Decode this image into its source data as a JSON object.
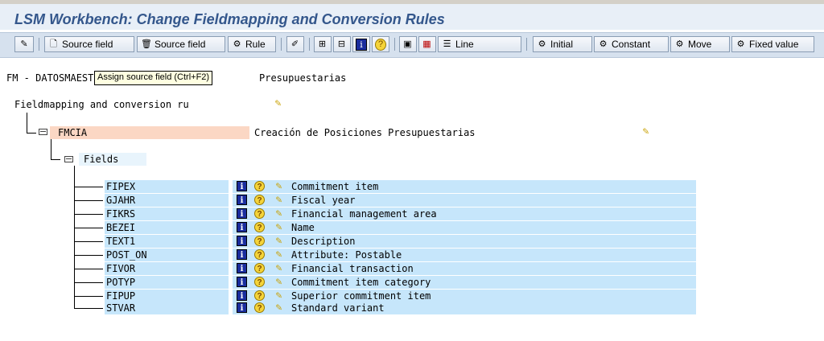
{
  "window": {
    "title": "LSM Workbench: Change Fieldmapping and Conversion Rules"
  },
  "toolbar": {
    "source_field_create": "Source field",
    "source_field_delete": "Source field",
    "rule": "Rule",
    "line": "Line",
    "initial": "Initial",
    "constant": "Constant",
    "move": "Move",
    "fixed_value": "Fixed value"
  },
  "header": {
    "fm_prefix": "FM - DATOSMAEST",
    "fm_suffix": "Presupuestarias",
    "tooltip": "Assign source field  (Ctrl+F2)"
  },
  "tree": {
    "root_label": "Fieldmapping and conversion ru",
    "structure": {
      "name": "FMCIA",
      "description": "Creación de Posiciones Presupuestarias"
    },
    "fields_node": "Fields",
    "fields": [
      {
        "name": "FIPEX",
        "description": "Commitment item"
      },
      {
        "name": "GJAHR",
        "description": "Fiscal year"
      },
      {
        "name": "FIKRS",
        "description": "Financial management area"
      },
      {
        "name": "BEZEI",
        "description": "Name"
      },
      {
        "name": "TEXT1",
        "description": "Description"
      },
      {
        "name": "POST_ON",
        "description": "Attribute: Postable"
      },
      {
        "name": "FIVOR",
        "description": "Financial transaction"
      },
      {
        "name": "POTYP",
        "description": "Commitment item category"
      },
      {
        "name": "FIPUP",
        "description": "Superior commitment item"
      },
      {
        "name": "STVAR",
        "description": "Standard variant"
      }
    ]
  },
  "colors": {
    "title": "#34578c",
    "field_highlight": "#c6e6fb",
    "structure_highlight": "#fbd7c4"
  }
}
